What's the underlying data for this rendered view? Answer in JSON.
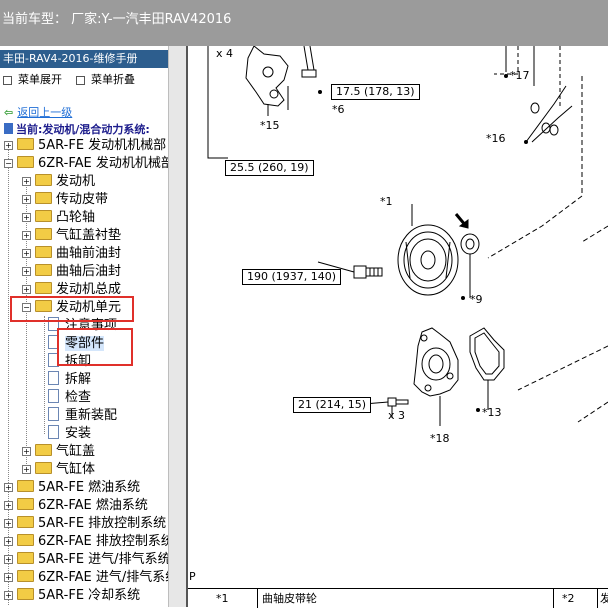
{
  "window": {
    "title": "当前车型：  厂家:Y-一汽丰田RAV42016"
  },
  "sidebar": {
    "brand": "丰田-RAV4-2016-维修手册",
    "expand_label": "菜单展开",
    "collapse_label": "菜单折叠",
    "back_label": "返回上一级",
    "current_path": "当前:发动机/混合动力系统:",
    "tree": [
      {
        "label": "5AR-FE 发动机机械部",
        "indent": 0,
        "type": "folder",
        "pm": "+"
      },
      {
        "label": "6ZR-FAE 发动机机械部",
        "indent": 0,
        "type": "folder",
        "pm": "-"
      },
      {
        "label": "发动机",
        "indent": 1,
        "type": "folder",
        "pm": "+"
      },
      {
        "label": "传动皮带",
        "indent": 1,
        "type": "folder",
        "pm": "+"
      },
      {
        "label": "凸轮轴",
        "indent": 1,
        "type": "folder",
        "pm": "+"
      },
      {
        "label": "气缸盖衬垫",
        "indent": 1,
        "type": "folder",
        "pm": "+"
      },
      {
        "label": "曲轴前油封",
        "indent": 1,
        "type": "folder",
        "pm": "+"
      },
      {
        "label": "曲轴后油封",
        "indent": 1,
        "type": "folder",
        "pm": "+"
      },
      {
        "label": "发动机总成",
        "indent": 1,
        "type": "folder",
        "pm": "+"
      },
      {
        "label": "发动机单元",
        "indent": 1,
        "type": "folder",
        "pm": "-"
      },
      {
        "label": "注意事项",
        "indent": 2,
        "type": "doc"
      },
      {
        "label": "零部件",
        "indent": 2,
        "type": "doc",
        "selected": true
      },
      {
        "label": "拆卸",
        "indent": 2,
        "type": "doc"
      },
      {
        "label": "拆解",
        "indent": 2,
        "type": "doc"
      },
      {
        "label": "检查",
        "indent": 2,
        "type": "doc"
      },
      {
        "label": "重新装配",
        "indent": 2,
        "type": "doc"
      },
      {
        "label": "安装",
        "indent": 2,
        "type": "doc"
      },
      {
        "label": "气缸盖",
        "indent": 1,
        "type": "folder",
        "pm": "+"
      },
      {
        "label": "气缸体",
        "indent": 1,
        "type": "folder",
        "pm": "+"
      },
      {
        "label": "5AR-FE 燃油系统",
        "indent": 0,
        "type": "folder",
        "pm": "+"
      },
      {
        "label": "6ZR-FAE 燃油系统",
        "indent": 0,
        "type": "folder",
        "pm": "+"
      },
      {
        "label": "5AR-FE 排放控制系统",
        "indent": 0,
        "type": "folder",
        "pm": "+"
      },
      {
        "label": "6ZR-FAE 排放控制系统",
        "indent": 0,
        "type": "folder",
        "pm": "+"
      },
      {
        "label": "5AR-FE 进气/排气系统",
        "indent": 0,
        "type": "folder",
        "pm": "+"
      },
      {
        "label": "6ZR-FAE 进气/排气系统",
        "indent": 0,
        "type": "folder",
        "pm": "+"
      },
      {
        "label": "5AR-FE 冷却系统",
        "indent": 0,
        "type": "folder",
        "pm": "+"
      }
    ]
  },
  "diagram": {
    "callouts": {
      "c1": "17.5 (178, 13)",
      "c2": "25.5 (260, 19)",
      "c3": "190 (1937, 140)",
      "c4": "21 (214, 15)"
    },
    "labels": {
      "x4": "x 4",
      "x3": "x 3",
      "p15": "*15",
      "p6": "*6",
      "p17": "*17",
      "p16": "*16",
      "p1": "*1",
      "p9": "*9",
      "p13": "*13",
      "p18": "*18",
      "p": "P"
    }
  },
  "bottom_table": {
    "cells": [
      "*1",
      "曲轴皮带轮",
      "*2",
      "发"
    ]
  }
}
